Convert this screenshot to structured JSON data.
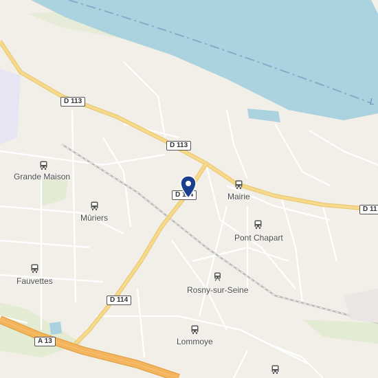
{
  "map": {
    "places": {
      "grande_maison": "Grande Maison",
      "muriers": "Mûriers",
      "fauvettes": "Fauvettes",
      "mairie": "Mairie",
      "pont_chapart": "Pont Chapart",
      "rosny": "Rosny-sur-Seine",
      "lommoye": "Lommoye"
    },
    "roads": {
      "d113_a": "D 113",
      "d113_b": "D 113",
      "d113_c": "D 11",
      "d114_a": "D 114",
      "d114_b": "D 114",
      "a13": "A 13"
    },
    "river_label": "L",
    "icons": {
      "bus": "bus-stop-icon",
      "train": "train-station-icon",
      "pin": "location-pin-icon"
    },
    "colors": {
      "land": "#f2efe9",
      "water": "#aad3df",
      "main_road": "#f7d98b",
      "motorway": "#f3b45c",
      "pin": "#1b3f8f"
    }
  }
}
